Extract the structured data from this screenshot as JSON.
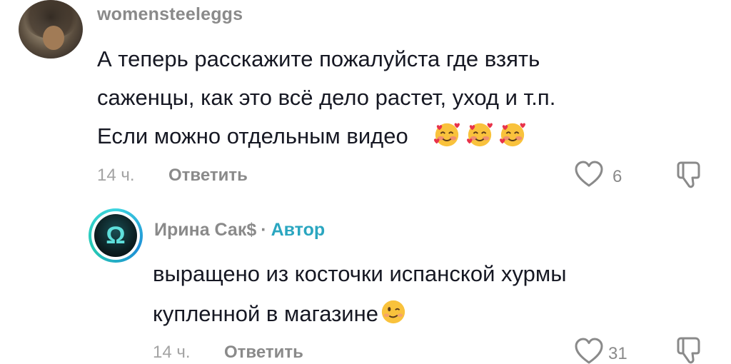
{
  "comment1": {
    "username": "womensteeleggs",
    "line1": "А теперь расскажите пожалуйста где взять",
    "line2": "саженцы, как это всё дело растет, уход и т.п.",
    "line3": "Если можно отдельным видео",
    "emojis": [
      "smiling-face-with-hearts",
      "smiling-face-with-hearts",
      "smiling-face-with-hearts"
    ],
    "time": "14 ч.",
    "reply_label": "Ответить",
    "likes": "6"
  },
  "comment2": {
    "username": "Ирина Сак$",
    "separator": "·",
    "badge": "Автор",
    "line1": "выращено из косточки испанской хурмы",
    "line2": "купленной в магазине",
    "emoji": "winking-face",
    "time": "14 ч.",
    "reply_label": "Ответить",
    "likes": "31"
  },
  "colors": {
    "author_badge": "#2aa6c0",
    "text": "#161823",
    "muted": "#8a8a8a"
  }
}
